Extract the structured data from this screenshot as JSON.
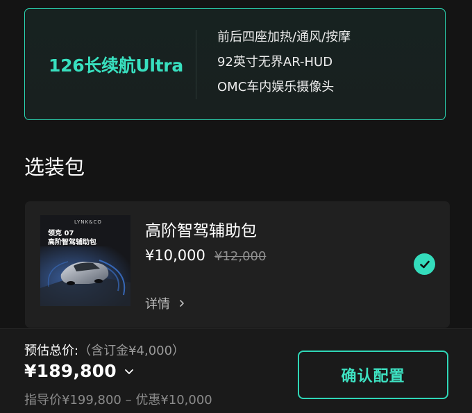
{
  "trim": {
    "name": "126长续航Ultra",
    "features": [
      "前后四座加热/通风/按摩",
      "92英寸无界AR-HUD",
      "OMC车内娱乐摄像头"
    ]
  },
  "section": {
    "title": "选装包"
  },
  "package": {
    "thumbnail": {
      "brand": "LYNK&CO",
      "line1": "领克 07",
      "line2": "高阶智驾辅助包"
    },
    "name": "高阶智驾辅助包",
    "price": "¥10,000",
    "original_price": "¥12,000",
    "details_label": "详情",
    "selected": true
  },
  "footer": {
    "estimate_label": "预估总价:",
    "deposit": "（含订金¥4,000）",
    "total": "¥189,800",
    "guide": "指导价¥199,800 – 优惠¥10,000",
    "confirm_label": "确认配置"
  },
  "colors": {
    "accent": "#2bd9b5",
    "background": "#141414",
    "card": "#202020"
  }
}
